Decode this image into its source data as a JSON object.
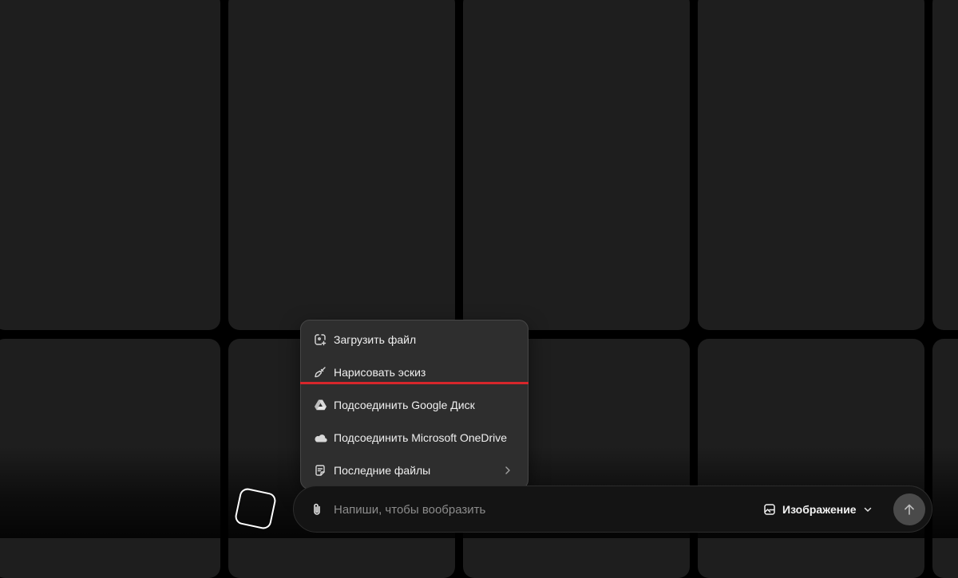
{
  "menu": {
    "items": [
      {
        "label": "Загрузить файл",
        "icon": "upload-file-icon"
      },
      {
        "label": "Нарисовать эскиз",
        "icon": "brush-icon"
      },
      {
        "label": "Подсоединить Google Диск",
        "icon": "google-drive-icon"
      },
      {
        "label": "Подсоединить Microsoft OneDrive",
        "icon": "onedrive-cloud-icon"
      },
      {
        "label": "Последние файлы",
        "icon": "recent-files-icon",
        "has_submenu": true
      }
    ],
    "highlighted_item": "Нарисовать эскиз",
    "highlight_color": "#d7262b"
  },
  "prompt": {
    "placeholder": "Напиши, чтобы вообразить",
    "value": ""
  },
  "mode_selector": {
    "label": "Изображение",
    "icon": "image-mode-icon"
  },
  "colors": {
    "background": "#000000",
    "tile": "#1e1e1e",
    "menu_bg": "#2e2e2e",
    "send_button": "#4a4a4a"
  }
}
